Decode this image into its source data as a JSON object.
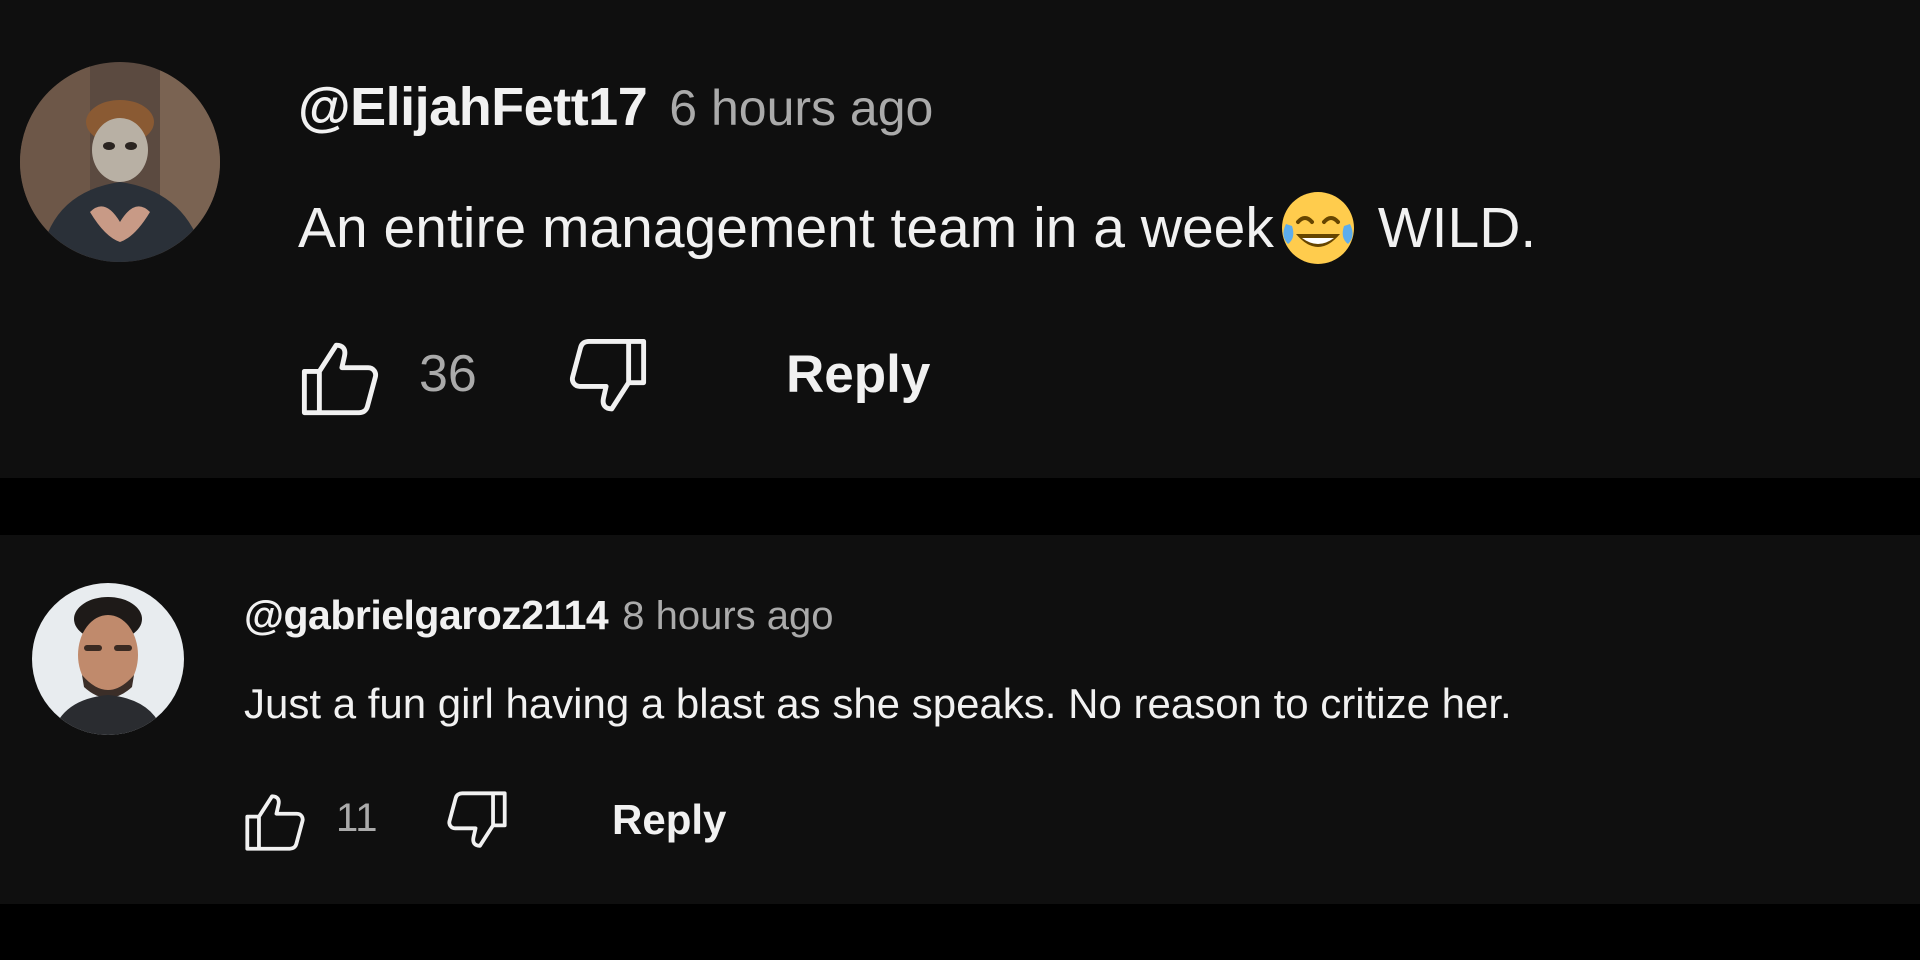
{
  "comments": [
    {
      "author": "@ElijahFett17",
      "time": "6 hours ago",
      "text_before_emoji": "An entire management team in a week",
      "emoji": "face-with-tears-of-joy",
      "text_after_emoji": "WILD.",
      "likes": "36",
      "reply_label": "Reply"
    },
    {
      "author": "@gabrielgaroz2114",
      "time": "8 hours ago",
      "text": "Just a fun girl having a blast as she speaks. No reason to critize her.",
      "likes": "11",
      "reply_label": "Reply"
    }
  ],
  "icons": {
    "like": "thumbs-up-icon",
    "dislike": "thumbs-down-icon"
  },
  "colors": {
    "page_background": "#000000",
    "card_background": "#0f0f0f",
    "primary_text": "#f1f1f1",
    "secondary_text": "#aaaaaa"
  }
}
